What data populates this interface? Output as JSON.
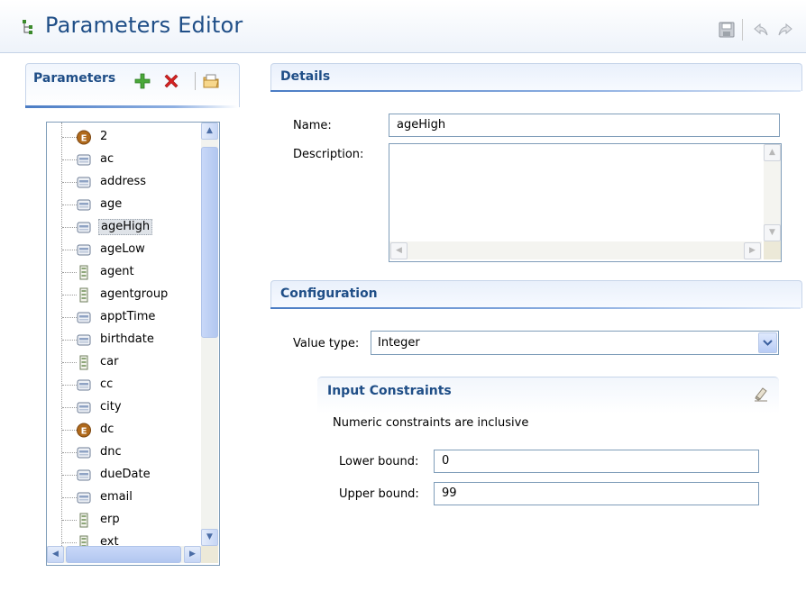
{
  "editor": {
    "title": "Parameters Editor"
  },
  "parameters_panel": {
    "title": "Parameters",
    "items": [
      {
        "label": "2",
        "icon": "enum-icon"
      },
      {
        "label": "ac",
        "icon": "field-icon"
      },
      {
        "label": "address",
        "icon": "field-icon"
      },
      {
        "label": "age",
        "icon": "field-icon"
      },
      {
        "label": "ageHigh",
        "icon": "field-icon",
        "selected": true
      },
      {
        "label": "ageLow",
        "icon": "field-icon"
      },
      {
        "label": "agent",
        "icon": "document-icon"
      },
      {
        "label": "agentgroup",
        "icon": "document-icon"
      },
      {
        "label": "apptTime",
        "icon": "field-icon"
      },
      {
        "label": "birthdate",
        "icon": "field-icon"
      },
      {
        "label": "car",
        "icon": "document-icon"
      },
      {
        "label": "cc",
        "icon": "field-icon"
      },
      {
        "label": "city",
        "icon": "field-icon"
      },
      {
        "label": "dc",
        "icon": "enum-icon"
      },
      {
        "label": "dnc",
        "icon": "field-icon"
      },
      {
        "label": "dueDate",
        "icon": "field-icon"
      },
      {
        "label": "email",
        "icon": "field-icon"
      },
      {
        "label": "erp",
        "icon": "document-icon"
      },
      {
        "label": "ext",
        "icon": "document-icon"
      }
    ]
  },
  "details": {
    "title": "Details",
    "name_label": "Name:",
    "name_value": "ageHigh",
    "description_label": "Description:",
    "description_value": ""
  },
  "configuration": {
    "title": "Configuration",
    "value_type_label": "Value type:",
    "value_type_value": "Integer"
  },
  "constraints": {
    "title": "Input Constraints",
    "note": "Numeric constraints are inclusive",
    "lower_label": "Lower bound:",
    "lower_value": "0",
    "upper_label": "Upper bound:",
    "upper_value": "99"
  },
  "colors": {
    "accent": "#1f4e87",
    "section_line": "#4a7cc4",
    "input_border": "#7f9db9",
    "enum_icon": "#b06a1c",
    "add_icon": "#3c9a2c",
    "delete_icon": "#d62222"
  }
}
